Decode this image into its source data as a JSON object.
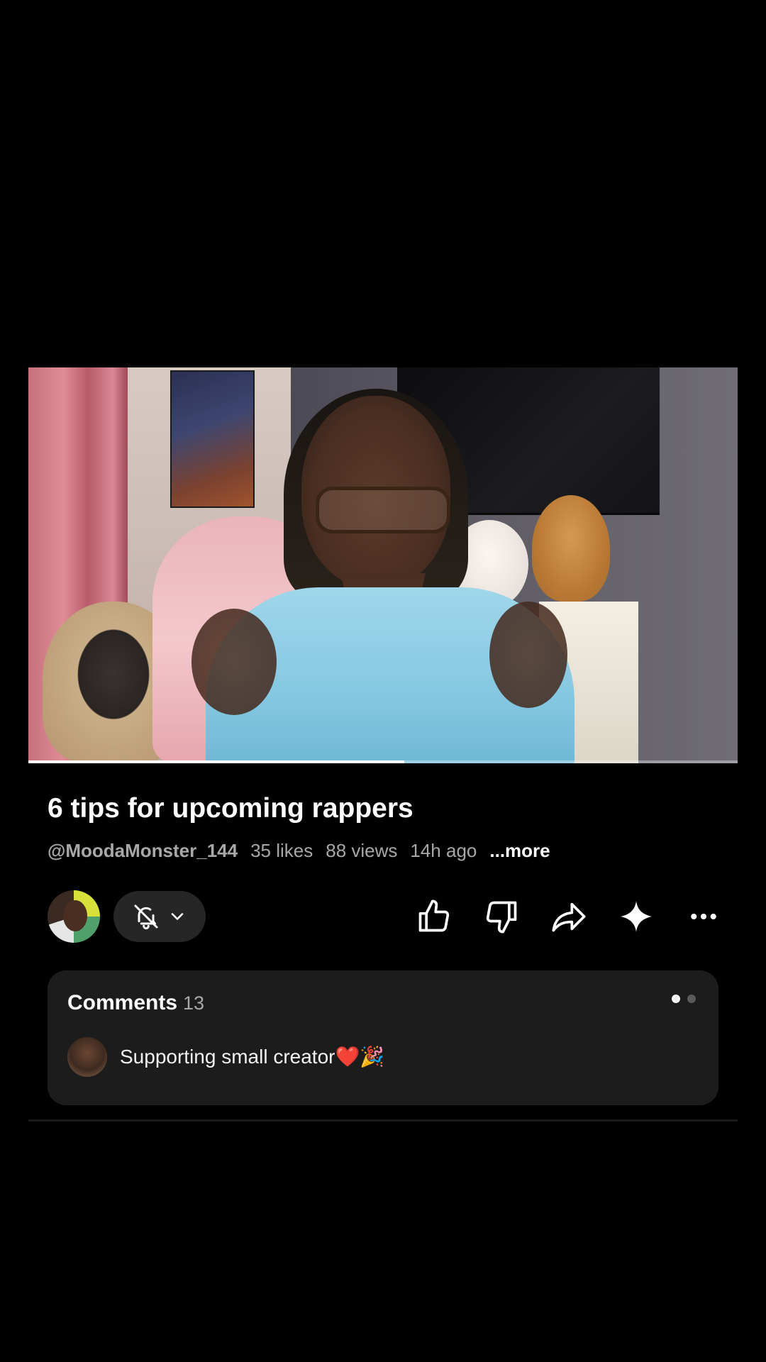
{
  "video": {
    "progress_fraction": 0.53
  },
  "title": "6 tips for upcoming rappers",
  "meta": {
    "channel": "@MoodaMonster_144",
    "likes": "35 likes",
    "views": "88 views",
    "age": "14h ago",
    "more": "...more"
  },
  "actions": {
    "icons": [
      "bell-off-icon",
      "chevron-down-icon",
      "thumbs-up-icon",
      "thumbs-down-icon",
      "share-icon",
      "sparkle-icon",
      "more-icon"
    ]
  },
  "comments": {
    "label": "Comments",
    "count": "13",
    "top_comment": "Supporting small creator❤️🎉",
    "pager_total": 2,
    "pager_active": 1
  },
  "colors": {
    "background": "#000000",
    "card": "#1c1c1c",
    "muted_text": "#a8a8a8",
    "pill": "#262626"
  }
}
